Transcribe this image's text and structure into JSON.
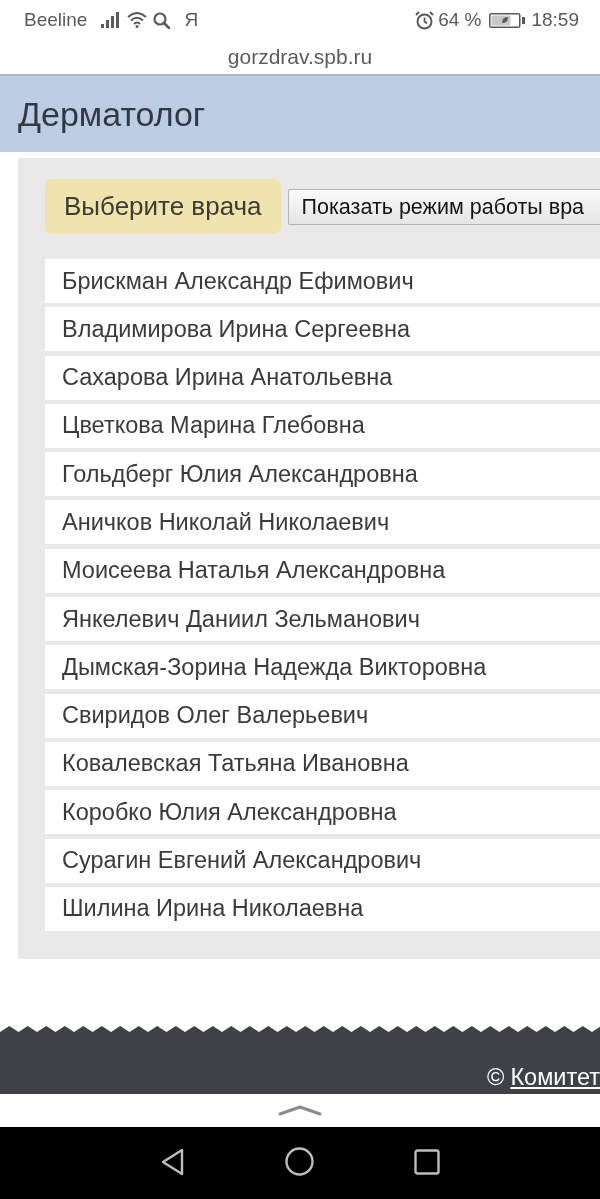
{
  "status_bar": {
    "carrier": "Beeline",
    "app_letter": "Я",
    "battery_percent": "64 %",
    "time": "18:59"
  },
  "address_bar": {
    "url": "gorzdrav.spb.ru"
  },
  "header": {
    "title": "Дерматолог"
  },
  "panel": {
    "choose_button": "Выберите врача",
    "schedule_button": "Показать режим работы вра",
    "doctors": [
      {
        "name": "Брискман Александр Ефимович",
        "selected": false
      },
      {
        "name": "Владимирова Ирина Сергеевна",
        "selected": false
      },
      {
        "name": "Сахарова Ирина Анатольевна",
        "selected": false
      },
      {
        "name": "Цветкова Марина Глебовна",
        "selected": false
      },
      {
        "name": "Гольдберг Юлия Александровна",
        "selected": false
      },
      {
        "name": "Аничков Николай Николаевич",
        "selected": false
      },
      {
        "name": "Моисеева Наталья Александровна",
        "selected": false
      },
      {
        "name": "Янкелевич Даниил Зельманович",
        "selected": false
      },
      {
        "name": "Дымская-Зорина Надежда Викторовна",
        "selected": false
      },
      {
        "name": "Свиридов Олег Валерьевич",
        "selected": false
      },
      {
        "name": "Ковалевская Татьяна Ивановна",
        "selected": false
      },
      {
        "name": "Коробко Юлия Александровна",
        "selected": false
      },
      {
        "name": "Сурагин Евгений Александрович",
        "selected": false
      },
      {
        "name": "Шилина Ирина Николаевна",
        "selected": false
      }
    ]
  },
  "footer": {
    "symbol": "©",
    "link": "Комитет"
  }
}
